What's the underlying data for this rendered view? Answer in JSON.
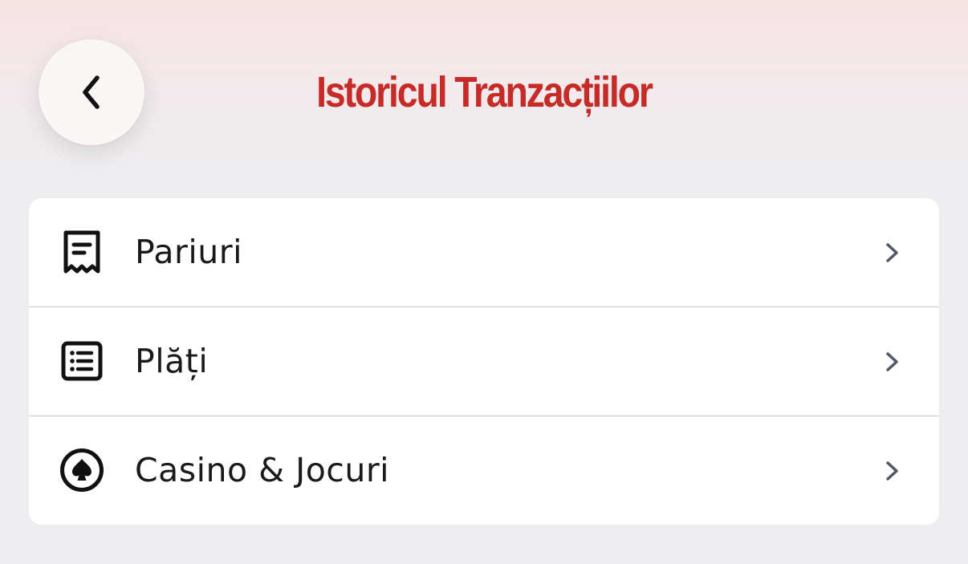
{
  "header": {
    "title": "Istoricul Tranzacțiilor",
    "back_icon": "chevron-left-icon",
    "title_color": "#c62b27"
  },
  "menu": {
    "items": [
      {
        "label": "Pariuri",
        "icon": "receipt-icon"
      },
      {
        "label": "Plăți",
        "icon": "list-icon"
      },
      {
        "label": "Casino & Jocuri",
        "icon": "spade-icon"
      }
    ],
    "chevron_icon": "chevron-right-icon"
  }
}
